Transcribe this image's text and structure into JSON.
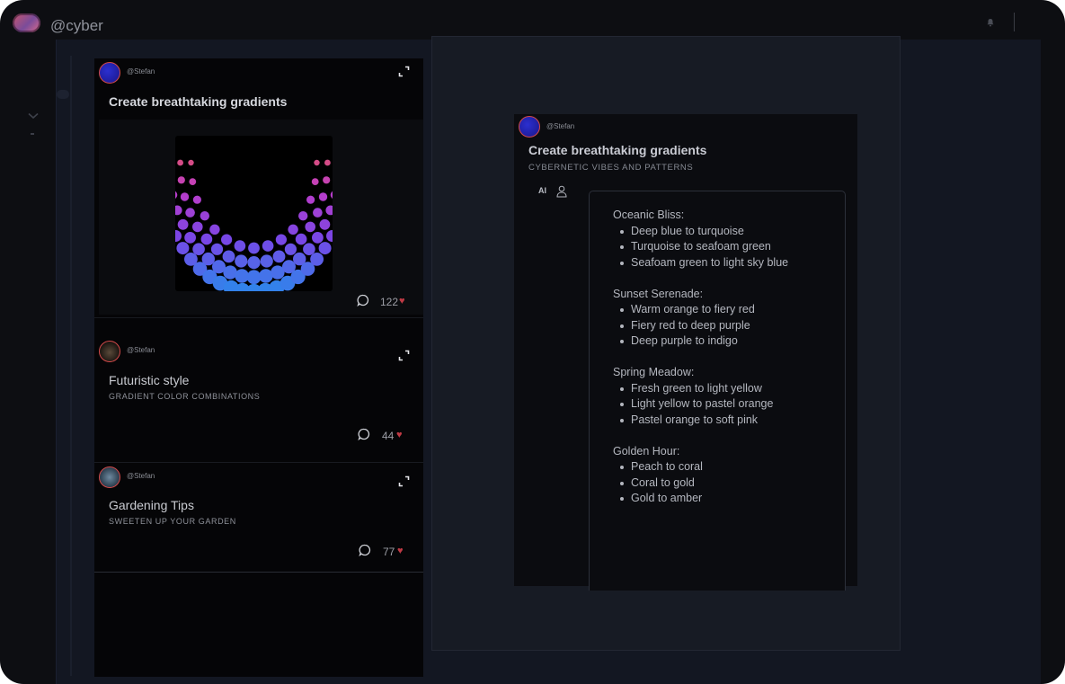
{
  "header": {
    "username": "@cyber"
  },
  "feed": {
    "posts": [
      {
        "user": "@Stefan",
        "title": "Create breathtaking gradients",
        "subtitle": "",
        "likes": "122"
      },
      {
        "user": "@Stefan",
        "title": "Futuristic style",
        "subtitle": "GRADIENT COLOR COMBINATIONS",
        "likes": "44"
      },
      {
        "user": "@Stefan",
        "title": "Gardening Tips",
        "subtitle": "SWEETEN UP YOUR GARDEN",
        "likes": "77"
      }
    ]
  },
  "detail": {
    "user": "@Stefan",
    "title": "Create breathtaking gradients",
    "subtitle": "CYBERNETIC VIBES AND PATTERNS",
    "ai_label": "AI",
    "sections": [
      {
        "heading": "Oceanic Bliss:",
        "items": [
          "Deep blue to turquoise",
          "Turquoise to seafoam green",
          "Seafoam green to light sky blue"
        ]
      },
      {
        "heading": "Sunset Serenade:",
        "items": [
          "Warm orange to fiery red",
          "Fiery red to deep purple",
          "Deep purple to indigo"
        ]
      },
      {
        "heading": "Spring Meadow:",
        "items": [
          "Fresh green to light yellow",
          "Light yellow to pastel orange",
          "Pastel orange to soft pink"
        ]
      },
      {
        "heading": "Golden Hour:",
        "items": [
          "Peach to coral",
          "Coral to gold",
          "Gold to amber"
        ]
      }
    ]
  },
  "icons": {
    "heart": "♥",
    "bell": "bell-icon",
    "expand": "expand-icon",
    "comment": "comment-icon",
    "user": "user-icon"
  },
  "colors": {
    "heart": "#c03a45",
    "avatar_ring": "#d24a4a",
    "background": "#0d0e12"
  }
}
